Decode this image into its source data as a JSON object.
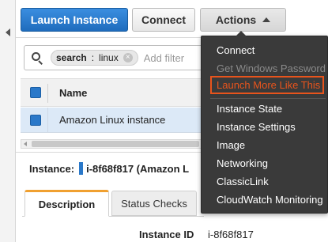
{
  "toolbar": {
    "launch_label": "Launch Instance",
    "connect_label": "Connect",
    "actions_label": "Actions"
  },
  "search": {
    "token_key": "search",
    "token_sep": ":",
    "token_value": "linux",
    "token_remove": "⊗",
    "placeholder": "Add filter"
  },
  "grid": {
    "columns": [
      "Name"
    ],
    "rows": [
      {
        "name": "Amazon Linux instance",
        "selected": true
      }
    ]
  },
  "details": {
    "instance_label": "Instance:",
    "instance_value": "i-8f68f817 (Amazon L",
    "tabs": [
      "Description",
      "Status Checks"
    ],
    "active_tab": "Description",
    "fields": [
      {
        "label": "Instance ID",
        "value": "i-8f68f817"
      }
    ]
  },
  "actions_menu": {
    "items": [
      {
        "label": "Connect",
        "state": "enabled"
      },
      {
        "label": "Get Windows Password",
        "state": "disabled"
      },
      {
        "label": "Launch More Like This",
        "state": "highlighted"
      },
      {
        "label": "Instance State",
        "state": "enabled"
      },
      {
        "label": "Instance Settings",
        "state": "enabled"
      },
      {
        "label": "Image",
        "state": "enabled"
      },
      {
        "label": "Networking",
        "state": "enabled"
      },
      {
        "label": "ClassicLink",
        "state": "enabled"
      },
      {
        "label": "CloudWatch Monitoring",
        "state": "enabled"
      }
    ]
  },
  "colors": {
    "primary_button": "#2f7fd0",
    "highlight": "#e8541c",
    "active_tab_accent": "#f0a030",
    "selected_row": "#dce9f7",
    "menu_background": "#3a3a3a"
  },
  "icons": [
    "collapse-left-icon",
    "search-icon",
    "token-remove-icon",
    "caret-up-icon"
  ]
}
